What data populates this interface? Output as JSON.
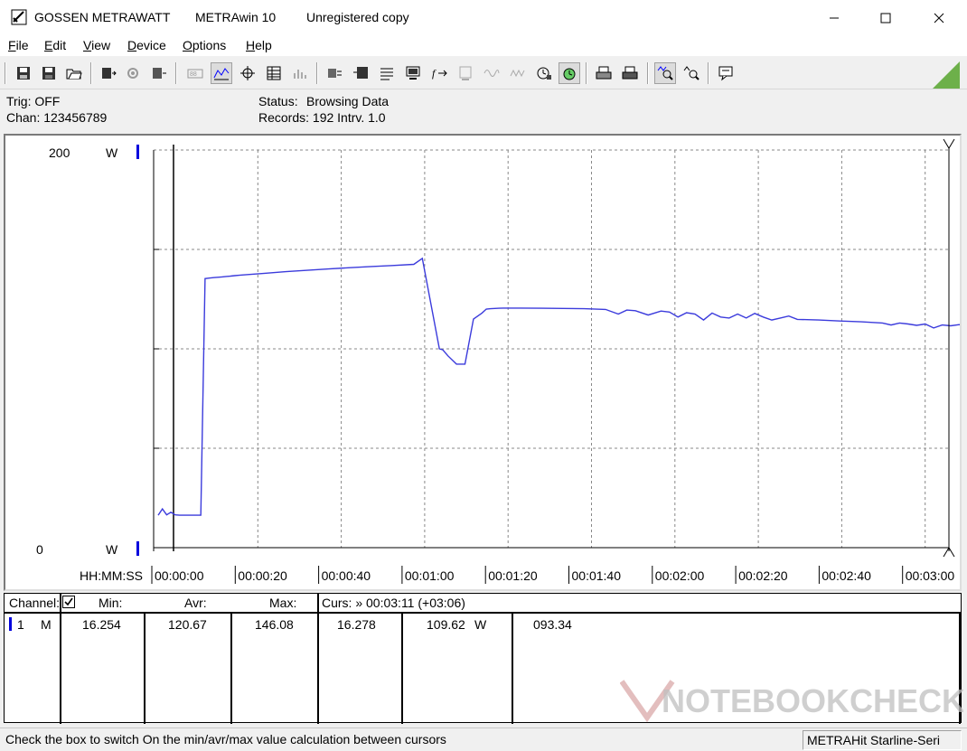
{
  "titlebar": {
    "brand": "GOSSEN METRAWATT",
    "app_name": "METRAwin 10",
    "license": "Unregistered copy",
    "icon": "gossen-app-icon"
  },
  "menu": {
    "items": [
      {
        "underline": "F",
        "rest": "ile"
      },
      {
        "underline": "E",
        "rest": "dit"
      },
      {
        "underline": "V",
        "rest": "iew"
      },
      {
        "underline": "D",
        "rest": "evice"
      },
      {
        "underline": "O",
        "rest": "ptions"
      },
      {
        "underline": "H",
        "rest": "elp"
      }
    ]
  },
  "info": {
    "trig": "Trig: OFF",
    "chan": "Chan:  123456789",
    "status_label": "Status:",
    "status_value": "Browsing Data",
    "records": "Records: 192  Intrv. 1.0"
  },
  "plot": {
    "y_top": "200",
    "y_bottom": "0",
    "unit_top": "W",
    "unit_bottom": "W",
    "x_axis_label": "HH:MM:SS",
    "x_ticks": [
      "00:00:00",
      "00:00:20",
      "00:00:40",
      "00:01:00",
      "00:01:20",
      "00:01:40",
      "00:02:00",
      "00:02:20",
      "00:02:40",
      "00:03:00"
    ],
    "line_color": "#3b3bdc"
  },
  "chart_data": {
    "type": "line",
    "xlabel": "HH:MM:SS",
    "ylabel": "W",
    "ylim": [
      0,
      200
    ],
    "x_unit": "seconds",
    "series": [
      {
        "x": [
          0,
          1,
          2,
          3,
          4,
          5,
          6,
          7,
          8,
          9,
          10,
          11,
          12,
          13,
          14,
          15,
          16,
          17,
          18,
          19,
          20,
          25,
          30,
          35,
          40,
          45,
          50,
          55,
          60,
          62,
          66,
          66.8,
          67,
          68,
          70,
          72,
          74,
          76,
          77,
          78,
          79,
          80,
          81,
          82,
          85,
          90,
          95,
          100,
          105,
          108,
          110,
          112,
          115,
          118,
          120,
          122,
          124,
          126,
          128,
          130,
          132,
          134,
          136,
          138,
          140,
          142,
          144,
          146,
          148,
          150,
          155,
          160,
          165,
          170,
          172,
          174,
          176,
          178,
          180,
          182,
          184,
          186,
          188,
          190,
          191
        ],
        "y": [
          16.3,
          19.5,
          16.5,
          17.8,
          16.5,
          16.3,
          16.3,
          16.3,
          16.3,
          16.3,
          16.3,
          135.3,
          135.6,
          135.8,
          136.0,
          136.2,
          136.4,
          136.6,
          136.8,
          137.0,
          137.2,
          138.0,
          138.8,
          139.5,
          140.2,
          140.8,
          141.4,
          141.9,
          142.5,
          145.5,
          100.0,
          99.5,
          99.0,
          96.5,
          92.3,
          92.3,
          115.0,
          118.0,
          120.0,
          120.2,
          120.3,
          120.4,
          120.5,
          120.5,
          120.5,
          120.4,
          120.3,
          120.2,
          119.8,
          117.5,
          119.5,
          119.2,
          117.0,
          119.0,
          118.5,
          116.0,
          118.2,
          117.5,
          114.5,
          118.0,
          116.0,
          115.5,
          117.5,
          115.5,
          117.8,
          116.0,
          114.5,
          115.5,
          116.5,
          114.8,
          114.5,
          114.0,
          113.6,
          113.0,
          112.0,
          113.0,
          112.5,
          111.8,
          112.5,
          110.5,
          112.0,
          111.6,
          112.2,
          111.0,
          109.6
        ]
      }
    ]
  },
  "table": {
    "headers": {
      "channel": "Channel:",
      "min": "Min:",
      "avr": "Avr:",
      "max": "Max:",
      "curs": "Curs: » 00:03:11 (+03:06)"
    },
    "row": {
      "index": "1",
      "mode": "M",
      "min": "16.254",
      "avr": "120.67",
      "max": "146.08",
      "curs_min": "16.278",
      "curs_value": "109.62",
      "curs_unit": "W",
      "curs_extra": "093.34"
    }
  },
  "status": {
    "hint": "Check the box to switch On the min/avr/max value calculation between cursors",
    "device": "METRAHit Starline-Seri"
  },
  "watermark": {
    "text": "NOTEBOOKCHECK"
  }
}
